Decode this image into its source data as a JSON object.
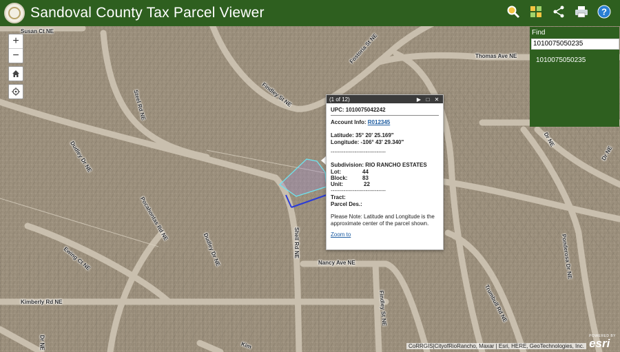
{
  "header": {
    "title": "Sandoval County Tax Parcel Viewer",
    "tools": [
      "zoom-search-icon",
      "basemap-grid-icon",
      "share-icon",
      "print-icon",
      "help-icon"
    ]
  },
  "map_controls": {
    "zoom_in": "+",
    "zoom_out": "−"
  },
  "streets": [
    "Susan Ct NE",
    "Fostoria St NE",
    "Thomas Ave NE",
    "Findley St NE",
    "Steel Rd NE",
    "Dudley Dr NE",
    "Pocahontas Rd NE",
    "Ewing Ct NE",
    "Dudley Dr NE",
    "Nancy Ave NE",
    "Kimberly Rd NE",
    "Findley St NE",
    "Shell Rd NE",
    "Trumbull Rd NE",
    "Ponderosa Dr NE",
    "Dr NE",
    "Dr NE",
    "Kim",
    "Dr NE"
  ],
  "find": {
    "label": "Find",
    "value": "1010075050235",
    "result": "1010075050235"
  },
  "popup": {
    "count": "(1 of 12)",
    "upc": "UPC: 1010075042242",
    "account_label": "Account Info:",
    "account_link": "R012345",
    "latitude": "Latitude: 35° 20' 25.169\"",
    "longitude": "Longitude: -106° 43' 29.340\"",
    "divider": "------------------------------",
    "subdivision_label": "Subdivision:",
    "subdivision": "RIO RANCHO ESTATES",
    "lot_label": "Lot:",
    "lot": "44",
    "block_label": "Block:",
    "block": "83",
    "unit_label": "Unit:",
    "unit": "22",
    "divider2": "------------------------------",
    "tract_label": "Tract:",
    "parcel_des_label": "Parcel Des.:",
    "note": "Please Note: Latitude and Longitude is the approximate center of the parcel shown.",
    "zoom_to": "Zoom to"
  },
  "attribution": "CoRRGIS|CityofRioRancho, Maxar | Esri, HERE, GeoTechnologies, Inc.",
  "esri": {
    "powered_by": "POWERED BY",
    "name": "esri"
  },
  "colors": {
    "header": "#2e5f1f",
    "parcel_selected": "#2a3bd8",
    "parcel_highlight": "#6fe3ee"
  }
}
